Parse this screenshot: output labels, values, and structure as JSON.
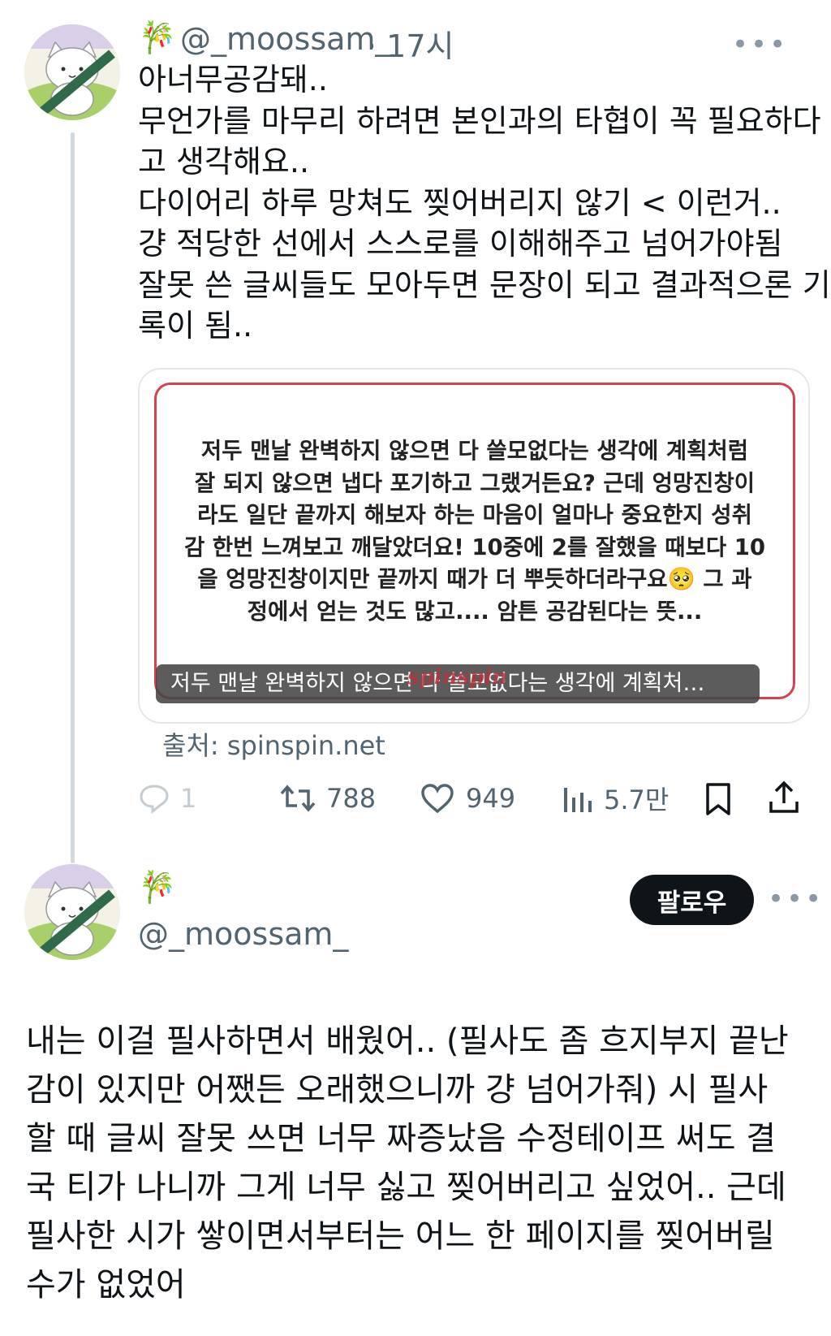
{
  "tweet1": {
    "emoji": "🎋",
    "handle": "@_moossam_",
    "time": "· 17시",
    "text_lines": [
      "아너무공감돼..",
      "무언가를 마무리 하려면 본인과의 타협이 꼭 필요하다",
      "고 생각해요..",
      "다이어리 하루 망쳐도 찢어버리지 않기 < 이런거..",
      "걍 적당한 선에서 스스로를 이해해주고 넘어가야됨",
      "잘못 쓴 글씨들도 모아두면 문장이 되고 결과적으론 기",
      "록이 됨.."
    ],
    "card": {
      "text_lines": [
        "저두 맨날 완벽하지 않으면 다 쓸모없다는 생각에 계획처럼",
        "잘 되지 않으면 냅다 포기하고 그랬거든요? 근데 엉망진창이",
        "라도 일단 끝까지 해보자 하는 마음이 얼마나 중요한지 성취",
        "감 한번 느껴보고 깨달았더요! 10중에 2를 잘했을 때보다 10",
        "을 엉망진창이지만 끝까지 때가 더 뿌듯하더라구요🥺 그 과",
        "정에서 얻는 것도 많고.... 암튼 공감된다는 뜻..."
      ],
      "caption": "저두 맨날 완벽하지 않으면 다 쓸모없다는 생각에 계획처…",
      "watermark": "spinspin"
    },
    "source": "출처: spinspin.net",
    "actions": {
      "reply_count": "1",
      "retweet_count": "788",
      "like_count": "949",
      "view_count": "5.7만"
    }
  },
  "tweet2": {
    "emoji": "🎋",
    "handle": "@_moossam_",
    "follow_label": "팔로우",
    "text_lines": [
      "내는 이걸 필사하면서 배웠어.. (필사도 좀 흐지부지 끝난",
      "감이 있지만 어쨌든 오래했으니까 걍 넘어가줘) 시 필사",
      "할 때 글씨 잘못 쓰면 너무 짜증났음 수정테이프 써도 결",
      "국 티가 나니까 그게 너무 싫고 찢어버리고 싶었어.. 근데",
      "필사한 시가 쌓이면서부터는 어느 한 페이지를 찢어버릴",
      "수가 없었어"
    ]
  },
  "more_label": "•••"
}
